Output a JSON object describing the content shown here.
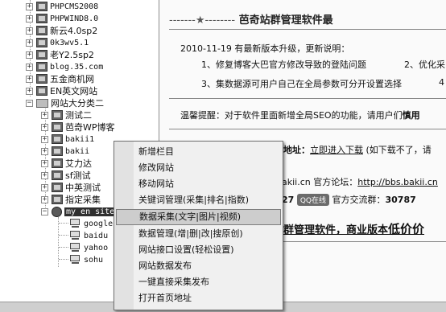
{
  "tree": {
    "sites": [
      {
        "label": "PHPCMS2008"
      },
      {
        "label": "PHPWIND8.0"
      },
      {
        "label": "新云4.0sp2"
      },
      {
        "label": "0k3wv5.1"
      },
      {
        "label": "老Y2.5sp2"
      },
      {
        "label": "blog.35.com"
      },
      {
        "label": "五金商机网"
      },
      {
        "label": "EN英文网站"
      }
    ],
    "category": {
      "label": "网站大分类二"
    },
    "sub_sites": [
      {
        "label": "测试二"
      },
      {
        "label": "芭奇WP博客"
      },
      {
        "label": "bakii1"
      },
      {
        "label": "bakii"
      },
      {
        "label": "艾力达"
      },
      {
        "label": "sf测试"
      },
      {
        "label": "中英测试"
      },
      {
        "label": "指定采集"
      }
    ],
    "selected_site": {
      "label": "my en site"
    },
    "engines": [
      {
        "label": "google"
      },
      {
        "label": "baidu"
      },
      {
        "label": "yahoo"
      },
      {
        "label": "sohu"
      }
    ]
  },
  "content": {
    "banner_left": "-------★--------",
    "banner_title": "芭奇站群管理软件最",
    "update_line": "2010-11-19 有最新版本升级，更新说明：",
    "item1": "1、修复博客大巴官方修改导致的登陆问题",
    "item2": "2、优化采",
    "item3": "3、集数据源可用户自己在全局参数可分开设置选择",
    "item4": "4",
    "tip": "温馨提醒：对于软件里面新增全局SEO的功能，请用户们",
    "tip_bold": "慎用",
    "addr_label": "地址：",
    "addr_link": "立即进入下载",
    "addr_note": "(如下载不了，请",
    "site_frag": "akii.cn",
    "forum_label": "官方论坛：",
    "forum_link": "http://bbs.bakii.cn",
    "qq_num_frag": "27",
    "qq_badge": "QQ在线",
    "group_label": "官方交流群：",
    "group_num": "30787",
    "slogan_a": "群管理软件，商业版本",
    "slogan_b": "低价价"
  },
  "menu": {
    "items": [
      {
        "label": "新增栏目"
      },
      {
        "label": "修改网站"
      },
      {
        "label": "移动网站"
      },
      {
        "label": "关键词管理(采集|排名|指数)"
      },
      {
        "label": "数据采集(文字|图片|视频)"
      },
      {
        "label": "数据管理(增|删|改|搜原创)"
      },
      {
        "label": "网站接口设置(轻松设置)"
      },
      {
        "label": "网站数据发布"
      },
      {
        "label": "一键直接采集发布"
      },
      {
        "label": "打开首页地址"
      }
    ],
    "highlighted_index": 4
  }
}
